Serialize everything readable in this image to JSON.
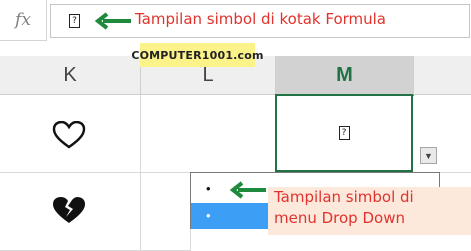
{
  "formula_bar": {
    "fx_label": "fx",
    "cell_content_glyph": "?"
  },
  "annotations": {
    "formula_note": "Tampilan simbol di kotak Formula",
    "dropdown_note_line1": "Tampilan simbol di",
    "dropdown_note_line2": "menu Drop Down",
    "color": "#e0332d",
    "arrow_color": "#1e8a3c"
  },
  "watermark": "COMPUTER1001.com",
  "columns": [
    {
      "label": "K",
      "selected": false
    },
    {
      "label": "L",
      "selected": false
    },
    {
      "label": "M",
      "selected": true
    }
  ],
  "cells": {
    "k_row1_icon": "heart-outline-icon",
    "k_row2_icon": "broken-heart-icon",
    "m_row1_glyph": "?"
  },
  "dropdown": {
    "items": [
      "•",
      "•"
    ],
    "highlighted_index": 1,
    "highlight_color": "#3c9ef5"
  },
  "accent": "#217346"
}
